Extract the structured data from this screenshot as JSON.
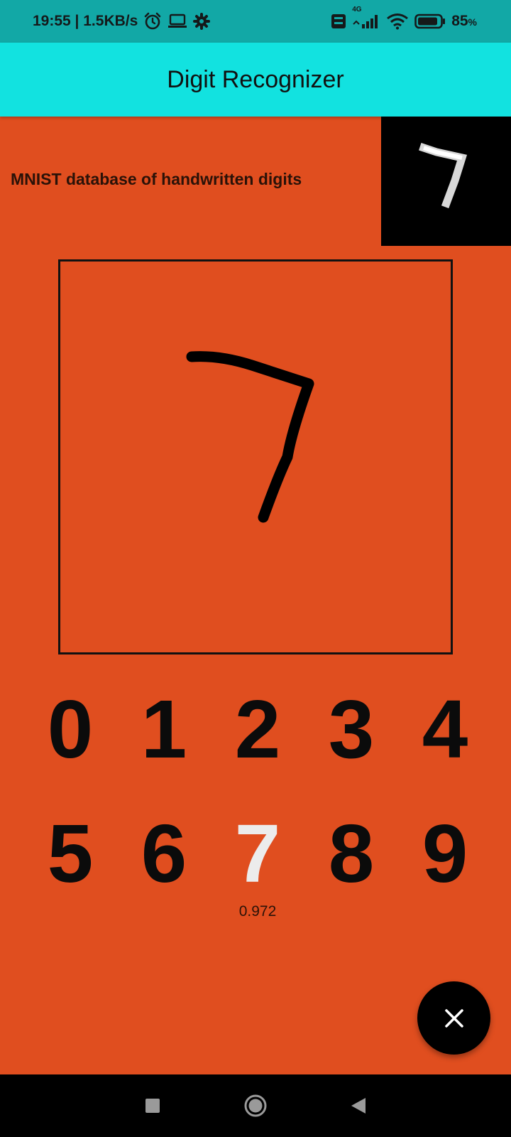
{
  "status_bar": {
    "time_speed": "19:55 | 1.5KB/s",
    "network_4g": "4G",
    "battery": "85",
    "battery_unit": "%"
  },
  "app_bar": {
    "title": "Digit Recognizer"
  },
  "main": {
    "database_label": "MNIST database of handwritten digits",
    "digits": [
      {
        "label": "0",
        "probability": ""
      },
      {
        "label": "1",
        "probability": ""
      },
      {
        "label": "2",
        "probability": ""
      },
      {
        "label": "3",
        "probability": ""
      },
      {
        "label": "4",
        "probability": ""
      },
      {
        "label": "5",
        "probability": ""
      },
      {
        "label": "6",
        "probability": ""
      },
      {
        "label": "7",
        "probability": "0.972"
      },
      {
        "label": "8",
        "probability": ""
      },
      {
        "label": "9",
        "probability": ""
      }
    ],
    "predicted_index": 7
  },
  "colors": {
    "status_bar": "#12a8a6",
    "app_bar": "#12e2e0",
    "background": "#e04e1f",
    "active_digit": "#ececec"
  },
  "icons": {
    "fab": "close-icon",
    "nav": [
      "recents-square-icon",
      "home-circle-icon",
      "back-triangle-icon"
    ]
  }
}
